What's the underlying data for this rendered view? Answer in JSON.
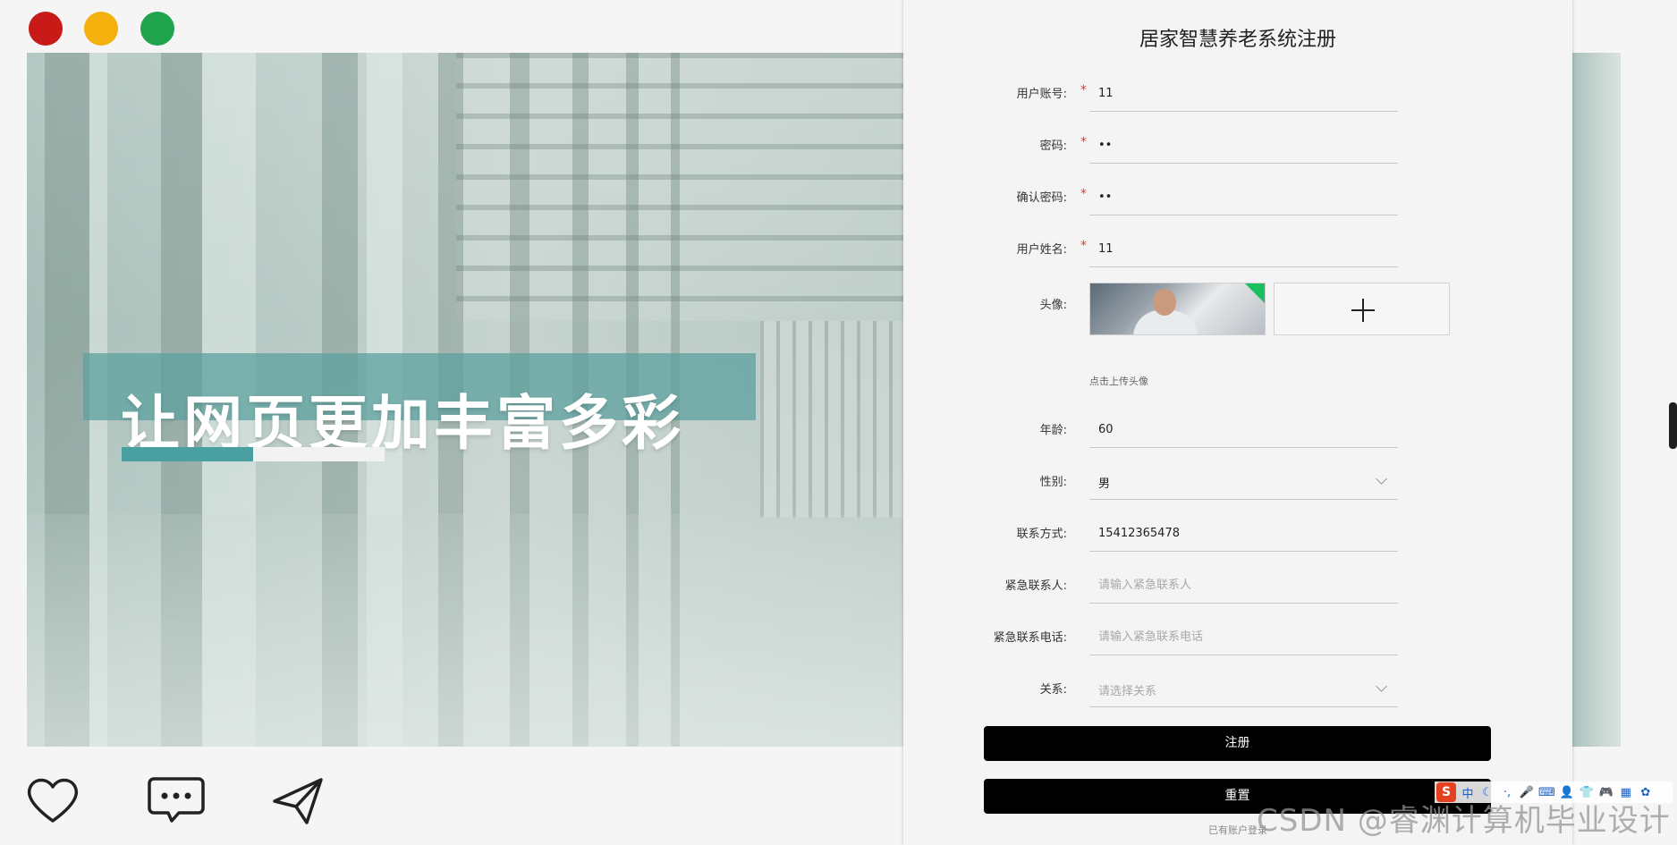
{
  "hero": {
    "title": "让网页更加丰富多彩",
    "progress": 0.5
  },
  "form": {
    "title": "居家智慧养老系统注册",
    "fields": [
      {
        "label": "用户账号:",
        "required": true,
        "value": "11",
        "type": "text",
        "placeholder": ""
      },
      {
        "label": "密码:",
        "required": true,
        "value": "11",
        "type": "password",
        "placeholder": ""
      },
      {
        "label": "确认密码:",
        "required": true,
        "value": "11",
        "type": "password",
        "placeholder": ""
      },
      {
        "label": "用户姓名:",
        "required": true,
        "value": "11",
        "type": "text",
        "placeholder": ""
      }
    ],
    "avatar": {
      "label": "头像:",
      "hint": "点击上传头像"
    },
    "fields2": [
      {
        "label": "年龄:",
        "value": "60",
        "type": "text",
        "placeholder": ""
      },
      {
        "label": "性别:",
        "value": "男",
        "type": "select",
        "placeholder": ""
      },
      {
        "label": "联系方式:",
        "value": "15412365478",
        "type": "text",
        "placeholder": ""
      },
      {
        "label": "紧急联系人:",
        "value": "",
        "type": "text",
        "placeholder": "请输入紧急联系人"
      },
      {
        "label": "紧急联系电话:",
        "value": "",
        "type": "text",
        "placeholder": "请输入紧急联系电话"
      },
      {
        "label": "关系:",
        "value": "",
        "type": "select",
        "placeholder": "请选择关系"
      }
    ],
    "register_label": "注册",
    "reset_label": "重置",
    "login_link": "已有账户登录"
  },
  "ime": {
    "lang": "中",
    "items": [
      "中",
      "☾",
      "·,",
      "🎤",
      "⌨",
      "👤",
      "👕",
      "🎮",
      "▦",
      "✿"
    ]
  },
  "watermark": "CSDN @睿渊计算机毕业设计",
  "colors": {
    "dot_red": "#c81a17",
    "dot_yellow": "#f4b10e",
    "dot_green": "#1fa34c",
    "hero_band": "#5ca09e",
    "hero_progress": "#4a9fa1",
    "button_bg": "#000000",
    "required_mark": "#e53935"
  }
}
